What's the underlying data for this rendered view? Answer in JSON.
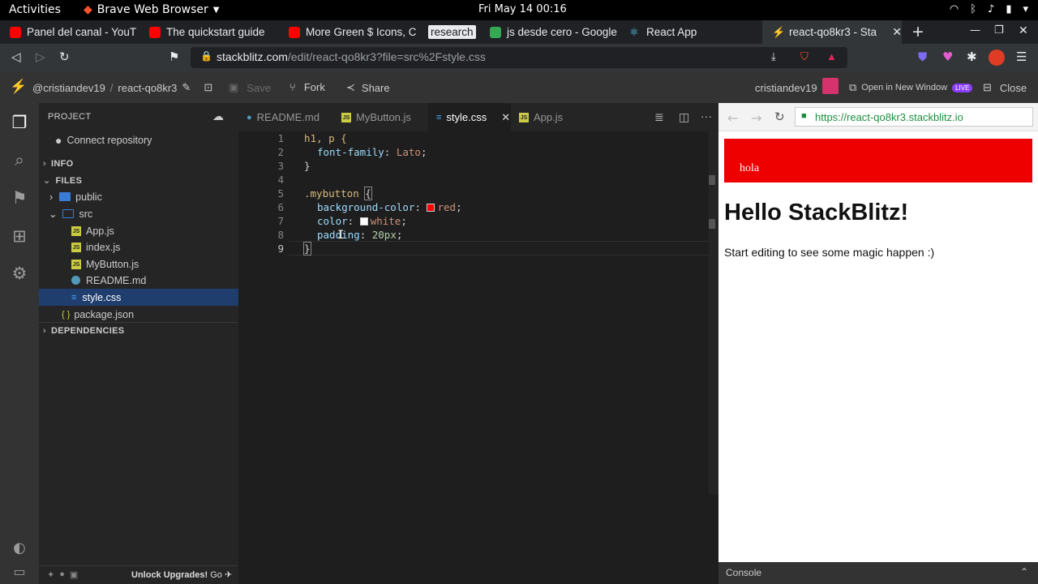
{
  "system": {
    "activities": "Activities",
    "app_name": "Brave Web Browser",
    "clock": "Fri May 14  00:16"
  },
  "browser": {
    "tabs": [
      {
        "label": "Panel del canal - YouT",
        "favicon_color": "#ff0000"
      },
      {
        "label": "The quickstart guide",
        "favicon_color": "#ff0000"
      },
      {
        "label": "More Green $ Icons, C",
        "favicon_color": "#ff0000"
      },
      {
        "label": "research",
        "favicon_color": ""
      },
      {
        "label": "js desde cero - Google",
        "favicon_color": "#34a853"
      },
      {
        "label": "React App",
        "favicon_color": "#61dafb"
      },
      {
        "label": "react-qo8kr3 - Sta",
        "favicon_color": "#1389fd"
      }
    ],
    "url_domain": "stackblitz.com",
    "url_path": "/edit/react-qo8kr3?file=src%2Fstyle.css"
  },
  "stackblitz": {
    "user_project": "@cristiandev19",
    "project_name": "react-qo8kr3",
    "save_label": "Save",
    "fork_label": "Fork",
    "share_label": "Share",
    "username": "cristiandev19",
    "open_new_window": "Open in New Window",
    "live_badge": "LIVE",
    "close_label": "Close"
  },
  "sidebar": {
    "project_header": "PROJECT",
    "connect_repo": "Connect repository",
    "info_header": "INFO",
    "files_header": "FILES",
    "tree": {
      "public": "public",
      "src": "src",
      "app_js": "App.js",
      "index_js": "index.js",
      "mybutton_js": "MyButton.js",
      "readme_md": "README.md",
      "style_css": "style.css",
      "package_json": "package.json"
    },
    "dependencies_header": "DEPENDENCIES",
    "unlock_label": "Unlock Upgrades!",
    "go_label": "Go"
  },
  "editor": {
    "tabs": [
      "README.md",
      "MyButton.js",
      "style.css",
      "App.js"
    ],
    "active_tab": "style.css",
    "line_numbers": [
      "1",
      "2",
      "3",
      "4",
      "5",
      "6",
      "7",
      "8",
      "9"
    ],
    "lines": {
      "l1": "h1, p {",
      "l2_prop": "font-family",
      "l2_val": "Lato",
      "l3": "}",
      "l5_sel": ".mybutton",
      "l5_brace": "{",
      "l6_prop": "background-color",
      "l6_val": "red",
      "l7_prop": "color",
      "l7_val": "white",
      "l8_prop": "padding",
      "l8_val": "20px",
      "l9": "}"
    }
  },
  "preview": {
    "url": "https://react-qo8kr3.stackblitz.io",
    "button_text": "hola",
    "heading": "Hello StackBlitz!",
    "paragraph": "Start editing to see some magic happen :)",
    "console_label": "Console"
  },
  "colors": {
    "accent_blue": "#1389fd",
    "button_red": "#ee0000",
    "selected_row": "#1f3e6e"
  }
}
